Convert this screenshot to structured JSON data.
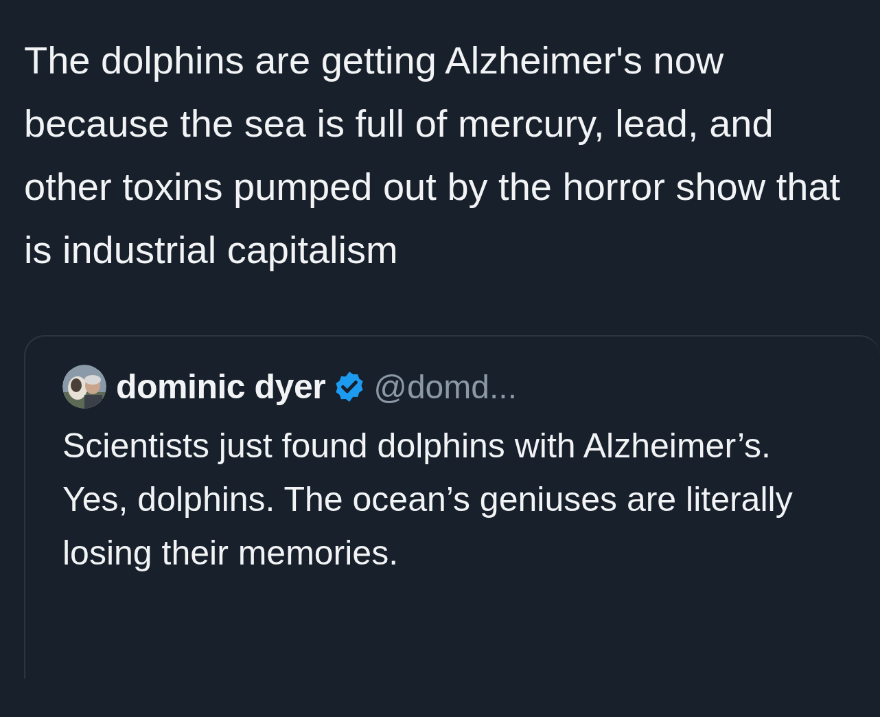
{
  "post": {
    "text": "The dolphins are getting Alzheimer's now because the sea is full of mercury, lead, and other toxins pumped out by the horror show that is industrial capitalism"
  },
  "quoted_post": {
    "author": {
      "name": "dominic dyer",
      "verified": true,
      "handle": "@domd..."
    },
    "text": "Scientists just found dolphins with Alzheimer’s. Yes, dolphins. The ocean’s geniuses are literally losing their memories."
  }
}
